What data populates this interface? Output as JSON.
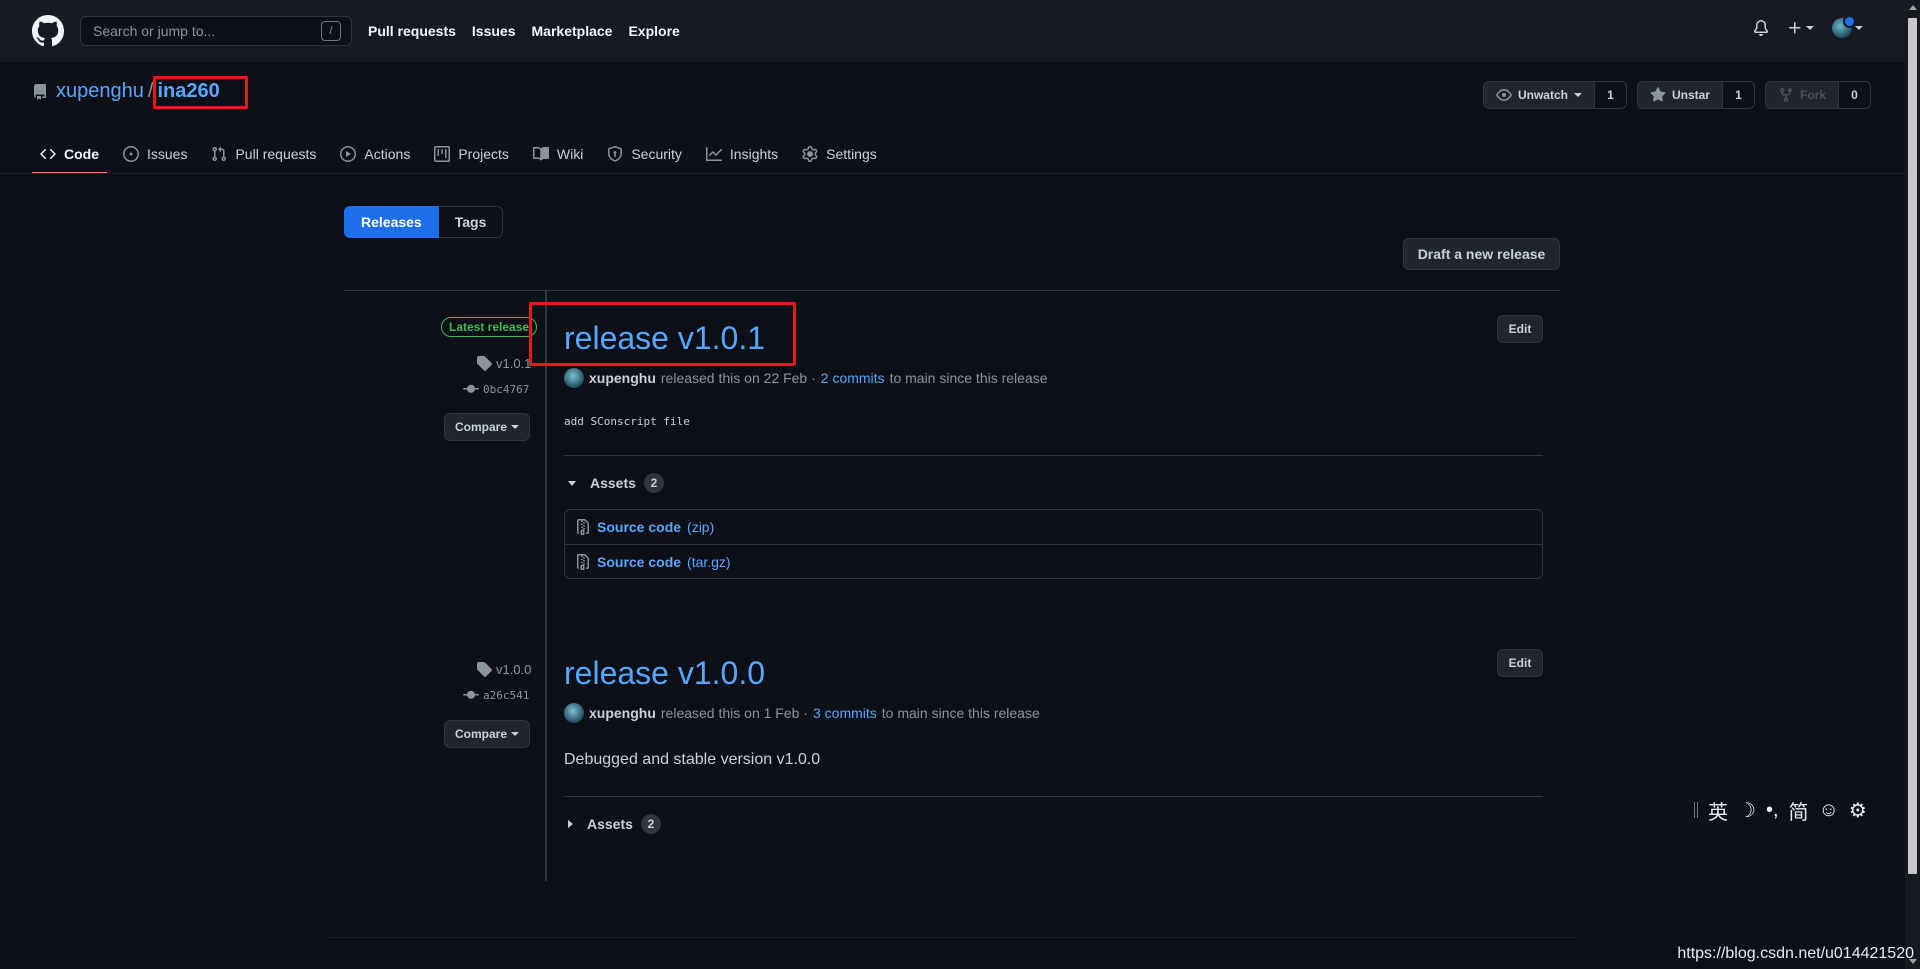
{
  "header": {
    "search_placeholder": "Search or jump to...",
    "search_key": "/",
    "nav": [
      "Pull requests",
      "Issues",
      "Marketplace",
      "Explore"
    ]
  },
  "repo": {
    "owner": "xupenghu",
    "separator": "/",
    "name": "ina260",
    "watch_label": "Unwatch",
    "watch_count": "1",
    "star_label": "Unstar",
    "star_count": "1",
    "fork_label": "Fork",
    "fork_count": "0"
  },
  "tabs": [
    {
      "label": "Code",
      "icon": "code-icon",
      "active": true
    },
    {
      "label": "Issues",
      "icon": "issue-icon"
    },
    {
      "label": "Pull requests",
      "icon": "pull-request-icon"
    },
    {
      "label": "Actions",
      "icon": "play-icon"
    },
    {
      "label": "Projects",
      "icon": "project-icon"
    },
    {
      "label": "Wiki",
      "icon": "book-icon"
    },
    {
      "label": "Security",
      "icon": "shield-icon"
    },
    {
      "label": "Insights",
      "icon": "graph-icon"
    },
    {
      "label": "Settings",
      "icon": "gear-icon"
    }
  ],
  "subnav": {
    "releases": "Releases",
    "tags": "Tags"
  },
  "draft_button": "Draft a new release",
  "releases": [
    {
      "badge": "Latest release",
      "tag": "v1.0.1",
      "commit": "0bc4767",
      "compare": "Compare",
      "title": "release v1.0.1",
      "edit": "Edit",
      "author": "xupenghu",
      "released_text": "released this on 22 Feb ·",
      "commits_link": "2 commits",
      "since_text": "to main since this release",
      "notes": "add SConscript file",
      "assets_label": "Assets",
      "assets_count": "2",
      "assets": [
        {
          "name": "Source code",
          "ext": "(zip)"
        },
        {
          "name": "Source code",
          "ext": "(tar.gz)"
        }
      ]
    },
    {
      "tag": "v1.0.0",
      "commit": "a26c541",
      "compare": "Compare",
      "title": "release v1.0.0",
      "edit": "Edit",
      "author": "xupenghu",
      "released_text": "released this on 1 Feb ·",
      "commits_link": "3 commits",
      "since_text": "to main since this release",
      "notes": "Debugged and stable version v1.0.0",
      "assets_label": "Assets",
      "assets_count": "2"
    }
  ],
  "ime_toolbar": {
    "lang": "英",
    "moon": "☽",
    "punct": "•,",
    "simplified": "简",
    "emoji": "☺",
    "gear": "⚙"
  },
  "watermark": "https://blog.csdn.net/u014421520",
  "colors": {
    "accent": "#58a6ff",
    "primary_button": "#1f6feb",
    "active_tab": "#f78166",
    "latest_badge": "#3fb950",
    "highlight_box": "#e8191a"
  }
}
